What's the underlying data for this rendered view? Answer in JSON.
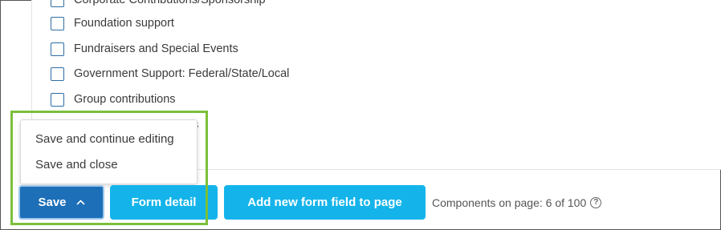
{
  "categories": [
    {
      "label": "Corporate Contributions/Sponsorship",
      "checked": false
    },
    {
      "label": "Foundation support",
      "checked": false
    },
    {
      "label": "Fundraisers and Special Events",
      "checked": false
    },
    {
      "label": "Government Support: Federal/State/Local",
      "checked": false
    },
    {
      "label": "Group contributions",
      "checked": false
    },
    {
      "label": "s",
      "checked": false
    }
  ],
  "save_menu": {
    "items": [
      "Save and continue editing",
      "Save and close"
    ]
  },
  "toolbar": {
    "save_label": "Save",
    "form_detail_label": "Form detail",
    "add_field_label": "Add new form field to page",
    "components_text": "Components on page: 6 of 100",
    "help_glyph": "?"
  },
  "colors": {
    "save_button": "#1d6fb8",
    "secondary_buttons": "#14b4ea",
    "highlight": "#7bbf3a",
    "checkbox_border": "#2e6da4"
  },
  "icons": {
    "save_chevron": "chevron-up-icon",
    "help": "help-circle-icon"
  }
}
